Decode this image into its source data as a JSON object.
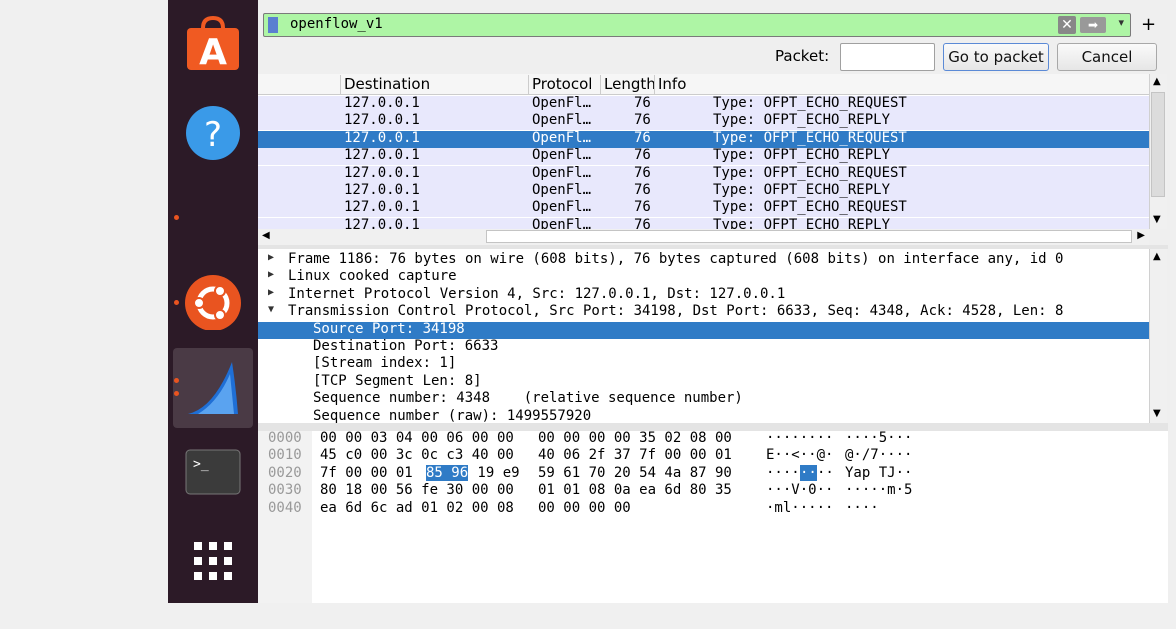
{
  "filter": {
    "text": "openflow_v1",
    "clear_icon": "clear-icon",
    "apply_icon": "apply-arrow-icon",
    "dropdown_icon": "chevron-down-icon",
    "add_label": "+"
  },
  "goto": {
    "packet_label": "Packet:",
    "packet_value": "",
    "go_label": "Go to packet",
    "cancel_label": "Cancel"
  },
  "packet_list": {
    "columns": [
      "Destination",
      "Protocol",
      "Length",
      "Info"
    ],
    "rows": [
      {
        "dst": "127.0.0.1",
        "proto": "OpenFl…",
        "len": "76",
        "info": "Type: OFPT_ECHO_REQUEST",
        "selected": false
      },
      {
        "dst": "127.0.0.1",
        "proto": "OpenFl…",
        "len": "76",
        "info": "Type: OFPT_ECHO_REPLY",
        "selected": false
      },
      {
        "dst": "127.0.0.1",
        "proto": "OpenFl…",
        "len": "76",
        "info": "Type: OFPT_ECHO_REQUEST",
        "selected": true
      },
      {
        "dst": "127.0.0.1",
        "proto": "OpenFl…",
        "len": "76",
        "info": "Type: OFPT_ECHO_REPLY",
        "selected": false
      },
      {
        "dst": "127.0.0.1",
        "proto": "OpenFl…",
        "len": "76",
        "info": "Type: OFPT_ECHO_REQUEST",
        "selected": false
      },
      {
        "dst": "127.0.0.1",
        "proto": "OpenFl…",
        "len": "76",
        "info": "Type: OFPT_ECHO_REPLY",
        "selected": false
      },
      {
        "dst": "127.0.0.1",
        "proto": "OpenFl…",
        "len": "76",
        "info": "Type: OFPT_ECHO_REQUEST",
        "selected": false
      },
      {
        "dst": "127.0.0.1",
        "proto": "OpenFl…",
        "len": "76",
        "info": "Type: OFPT_ECHO_REPLY",
        "selected": false
      }
    ]
  },
  "details": {
    "rows": [
      {
        "text": "Frame 1186: 76 bytes on wire (608 bits), 76 bytes captured (608 bits) on interface any, id 0",
        "level": 0,
        "arrow": "collapsed",
        "selected": false
      },
      {
        "text": "Linux cooked capture",
        "level": 0,
        "arrow": "collapsed",
        "selected": false
      },
      {
        "text": "Internet Protocol Version 4, Src: 127.0.0.1, Dst: 127.0.0.1",
        "level": 0,
        "arrow": "collapsed",
        "selected": false
      },
      {
        "text": "Transmission Control Protocol, Src Port: 34198, Dst Port: 6633, Seq: 4348, Ack: 4528, Len: 8",
        "level": 0,
        "arrow": "expanded",
        "selected": false
      },
      {
        "text": "Source Port: 34198",
        "level": 1,
        "arrow": "",
        "selected": true
      },
      {
        "text": "Destination Port: 6633",
        "level": 1,
        "arrow": "",
        "selected": false
      },
      {
        "text": "[Stream index: 1]",
        "level": 1,
        "arrow": "",
        "selected": false
      },
      {
        "text": "[TCP Segment Len: 8]",
        "level": 1,
        "arrow": "",
        "selected": false
      },
      {
        "text": "Sequence number: 4348    (relative sequence number)",
        "level": 1,
        "arrow": "",
        "selected": false
      },
      {
        "text": "Sequence number (raw): 1499557920",
        "level": 1,
        "arrow": "",
        "selected": false
      }
    ]
  },
  "bytes": {
    "rows": [
      {
        "offset": "0000",
        "hex_a": "00 00 03 04 00 06 00 00",
        "hex_b": "00 00 00 00 35 02 08 00",
        "ascii_a": "········",
        "ascii_b": "····5···"
      },
      {
        "offset": "0010",
        "hex_a": "45 c0 00 3c 0c c3 40 00",
        "hex_b": "40 06 2f 37 7f 00 00 01",
        "ascii_a": "E··<··@·",
        "ascii_b": "@·/7····"
      },
      {
        "offset": "0020",
        "hex_a": "7f 00 00 01 ",
        "hex_hl": "85 96",
        "hex_a2": " 19 e9",
        "hex_b": "59 61 70 20 54 4a 87 90",
        "ascii_a": "····",
        "ascii_hl": "··",
        "ascii_a2": "··",
        "ascii_b": "Yap TJ··"
      },
      {
        "offset": "0030",
        "hex_a": "80 18 00 56 fe 30 00 00",
        "hex_b": "01 01 08 0a ea 6d 80 35",
        "ascii_a": "···V·0··",
        "ascii_b": "·····m·5"
      },
      {
        "offset": "0040",
        "hex_a": "ea 6d 6c ad 01 02 00 08",
        "hex_b": "00 00 00 00",
        "ascii_a": "·ml·····",
        "ascii_b": "····"
      }
    ]
  },
  "dock": {
    "items": [
      "app-center-icon",
      "help-icon",
      "ubuntu-icon",
      "wireshark-icon",
      "terminal-icon",
      "show-apps-icon"
    ]
  },
  "colors": {
    "dock_bg": "#2c1a27",
    "selection": "#2f7bc6",
    "filter_bg": "#aef5a5",
    "row_bg": "#e8e8fc",
    "accent": "#e95420"
  }
}
